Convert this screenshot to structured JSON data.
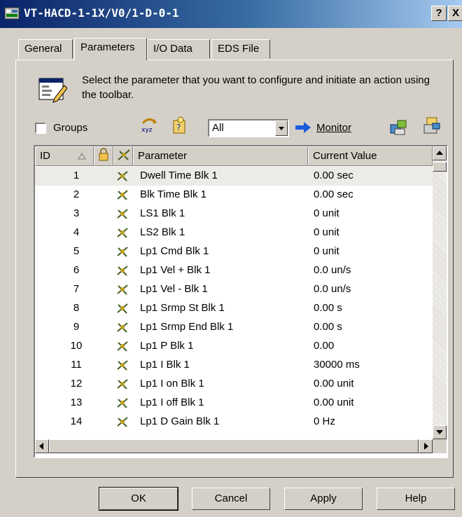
{
  "window": {
    "title": "VT-HACD-1-1X/V0/1-D-0-1",
    "help_label": "?",
    "close_label": "X"
  },
  "tabs": [
    {
      "label": "General",
      "active": false
    },
    {
      "label": "Parameters",
      "active": true
    },
    {
      "label": "I/O Data",
      "active": false
    },
    {
      "label": "EDS File",
      "active": false
    }
  ],
  "instruction": "Select the parameter that you want to configure and initiate an action using the toolbar.",
  "toolbar": {
    "groups_label": "Groups",
    "groups_checked": false,
    "filter_value": "All",
    "monitor_label": "Monitor"
  },
  "grid": {
    "columns": [
      "ID",
      "",
      "",
      "Parameter",
      "Current Value"
    ],
    "rows": [
      {
        "id": "1",
        "parameter": "Dwell Time Blk 1",
        "value": "0.00 sec"
      },
      {
        "id": "2",
        "parameter": "Blk Time Blk 1",
        "value": "0.00 sec"
      },
      {
        "id": "3",
        "parameter": "LS1 Blk 1",
        "value": "0 unit"
      },
      {
        "id": "4",
        "parameter": "LS2 Blk 1",
        "value": "0 unit"
      },
      {
        "id": "5",
        "parameter": "Lp1 Cmd Blk 1",
        "value": "0 unit"
      },
      {
        "id": "6",
        "parameter": "Lp1 Vel + Blk 1",
        "value": "0.0 un/s"
      },
      {
        "id": "7",
        "parameter": "Lp1 Vel - Blk 1",
        "value": "0.0 un/s"
      },
      {
        "id": "8",
        "parameter": "Lp1 Srmp St Blk 1",
        "value": "0.00 s"
      },
      {
        "id": "9",
        "parameter": "Lp1 Srmp End Blk 1",
        "value": "0.00 s"
      },
      {
        "id": "10",
        "parameter": "Lp1 P Blk 1",
        "value": "0.00"
      },
      {
        "id": "11",
        "parameter": "Lp1 I Blk 1",
        "value": "30000 ms"
      },
      {
        "id": "12",
        "parameter": "Lp1 I on Blk 1",
        "value": "0.00 unit"
      },
      {
        "id": "13",
        "parameter": "Lp1 I off Blk 1",
        "value": "0.00 unit"
      },
      {
        "id": "14",
        "parameter": "Lp1 D Gain Blk 1",
        "value": "0 Hz"
      }
    ]
  },
  "buttons": {
    "ok": "OK",
    "cancel": "Cancel",
    "apply": "Apply",
    "help": "Help"
  },
  "colors": {
    "title_bar_start": "#0a246a",
    "title_bar_end": "#a6caf0",
    "face": "#d4d0c8",
    "monitor_arrow": "#1e5adc"
  }
}
